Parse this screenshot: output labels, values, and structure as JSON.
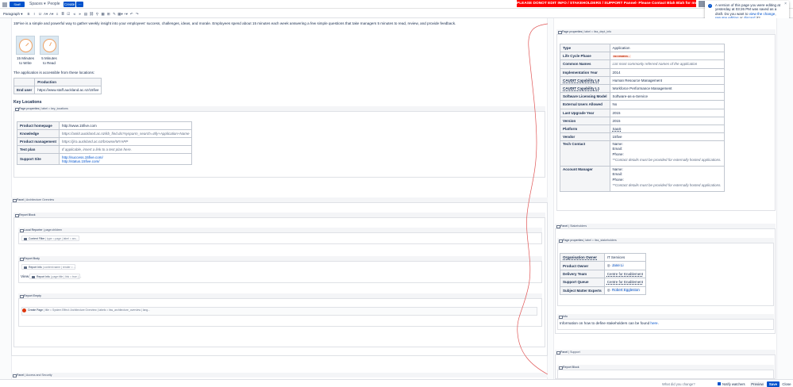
{
  "topnav": {
    "logo_text": "Staff",
    "spaces_label": "Spaces ▾",
    "people_label": "People",
    "create_label": "Create",
    "more_label": "⋯"
  },
  "alert": {
    "text": "PLEASE DONOT EDIT INFO / STAKEHOLDERS / SUPPORT Pannel- Please Contact Blah Blah for more information!"
  },
  "toolbar": {
    "format_label": "Paragraph ▾",
    "tools": [
      "B",
      "I",
      "U",
      "A▾",
      "A▾",
      "≡",
      "≣",
      "☑",
      "⫷",
      "⫸",
      "▤",
      "⛓",
      "⚲",
      "▦",
      "⊞",
      "✎",
      "▦▾",
      "+▾",
      "↶",
      "↷"
    ]
  },
  "notice": {
    "text_before": "A version of this page you were editing at yesterday at 03:26 PM was saved as a draft. Do you want to ",
    "link_view": "view the change",
    "text_mid": ", ",
    "link_resume": "resume editing",
    "text_or": " or ",
    "link_discard": "discard",
    "text_end": " it?",
    "close": "×"
  },
  "intro": {
    "description": "15Five is a simple and powerful way to gather weekly insight into your employees' success, challenges, ideas, and morale. Employees spend about 15 minutes each week answering a few simple questions that take managers 5 minutes to read, review, and provide feedback.",
    "gauge1": {
      "line1": "15 Minutes",
      "line2": "to Write"
    },
    "gauge2": {
      "line1": "5 Minutes",
      "line2": "to Read"
    },
    "access_text": "The application is accessible from these locations:",
    "access_table": {
      "header": [
        "",
        "Production"
      ],
      "rows": [
        [
          "End user",
          "https://www.staff.auckland.ac.nz/15five"
        ]
      ]
    },
    "key_locations": "Key Locations"
  },
  "macros": {
    "page_properties_keylocations": {
      "name": "Page properties",
      "params": "| label = key_locations"
    },
    "panel_architecture": {
      "name": "Panel",
      "params": "| Architecture Overview"
    },
    "report_block_left": {
      "name": "Report Block",
      "params": ""
    },
    "local_reporter": {
      "name": "Local Reporter",
      "params": "| page:children"
    },
    "content_filter": {
      "name": "Content Filter",
      "params": "| type = page | label = arc..."
    },
    "report_body": {
      "name": "Report Body",
      "params": ""
    },
    "report_info_1": {
      "name": "Report Info",
      "params": "| content:name | render = ..."
    },
    "view_label": "View",
    "report_info_2": {
      "name": "Report Info",
      "params": "| page:title | link = true | ..."
    },
    "report_empty": {
      "name": "Report Empty",
      "params": ""
    },
    "create_page": {
      "name": "Create Page",
      "params": "| title = System Effect: Architecture Overview | labels = itss_architecture_overview | lang..."
    },
    "panel_access": {
      "name": "Panel",
      "params": "| Access and Security"
    },
    "page_properties_info": {
      "name": "Page properties",
      "params": "| label = itss_dept_info"
    },
    "panel_stakeholders": {
      "name": "Panel",
      "params": "| Stakeholders"
    },
    "page_properties_stakeholders": {
      "name": "Page properties",
      "params": "| label = itss_stakeholders"
    },
    "info": {
      "name": "Info",
      "params": ""
    },
    "panel_support": {
      "name": "Panel",
      "params": "| Support"
    },
    "report_block_right": {
      "name": "Report Block",
      "params": ""
    }
  },
  "key_locations_table": [
    [
      "Product homepage",
      "http://www.15five.com"
    ],
    [
      "Knowledge",
      "https://askit.auckland.ac.nz/kb_find.do?sysparm_search=4ify+Application+Name"
    ],
    [
      "Product management",
      "https://jira.auckland.ac.nz/browse/MYAPP"
    ],
    [
      "Test plan",
      "If applicable, insert a link to a test plan here."
    ],
    [
      "Support Site",
      "http://success.15five.com/",
      "http://status.15five.com/"
    ]
  ],
  "app_info_table": [
    [
      "Type",
      "Application"
    ],
    [
      "Life Cycle Phase",
      "DECOMMISS..."
    ],
    [
      "Common Names",
      "List most commonly referred names of the application"
    ],
    [
      "Implementation Year",
      "2014"
    ],
    [
      "CAUDIT Capability L0",
      "Human Resource Management"
    ],
    [
      "CAUDIT Capability L1",
      "Workforce Performance Management"
    ],
    [
      "Software Licensing Model",
      "Software-as-a-Service"
    ],
    [
      "External Users Allowed",
      "No"
    ],
    [
      "Last Upgrade Year",
      "2015"
    ],
    [
      "Version",
      "2015"
    ],
    [
      "Platform",
      "SaaS"
    ],
    [
      "Vendor",
      "15five"
    ]
  ],
  "contact_rows": [
    {
      "label": "Tech Contact",
      "lines": [
        "Name:",
        "Email:",
        "Phone:"
      ],
      "note": "**Contact details must be provided for externally hosted applications."
    },
    {
      "label": "Account Manager",
      "lines": [
        "Name:",
        "Email:",
        "Phone:"
      ],
      "note": "**Contact details must be provided for externally hosted applications."
    }
  ],
  "stakeholders_table": [
    [
      "Organisation Owner",
      "IT Services"
    ],
    [
      "Product Owner",
      "Jane Li"
    ],
    [
      "Delivery Team",
      "Centre for Enablement"
    ],
    [
      "Support Queue",
      "Centre for Enablement"
    ],
    [
      "Subject Matter Experts",
      "Robert Eggleston"
    ]
  ],
  "info_text": {
    "before": "Information on how to define stakeholders can be found ",
    "link": "here",
    "after": "."
  },
  "bottombar": {
    "search_placeholder": "What did you change?",
    "notify_label": "Notify watchers",
    "preview_label": "Preview",
    "save_label": "Save",
    "close_label": "Close"
  },
  "colors": {
    "accent": "#0052cc",
    "alert": "#ff0000",
    "macro_bg": "#f4f5f7"
  }
}
